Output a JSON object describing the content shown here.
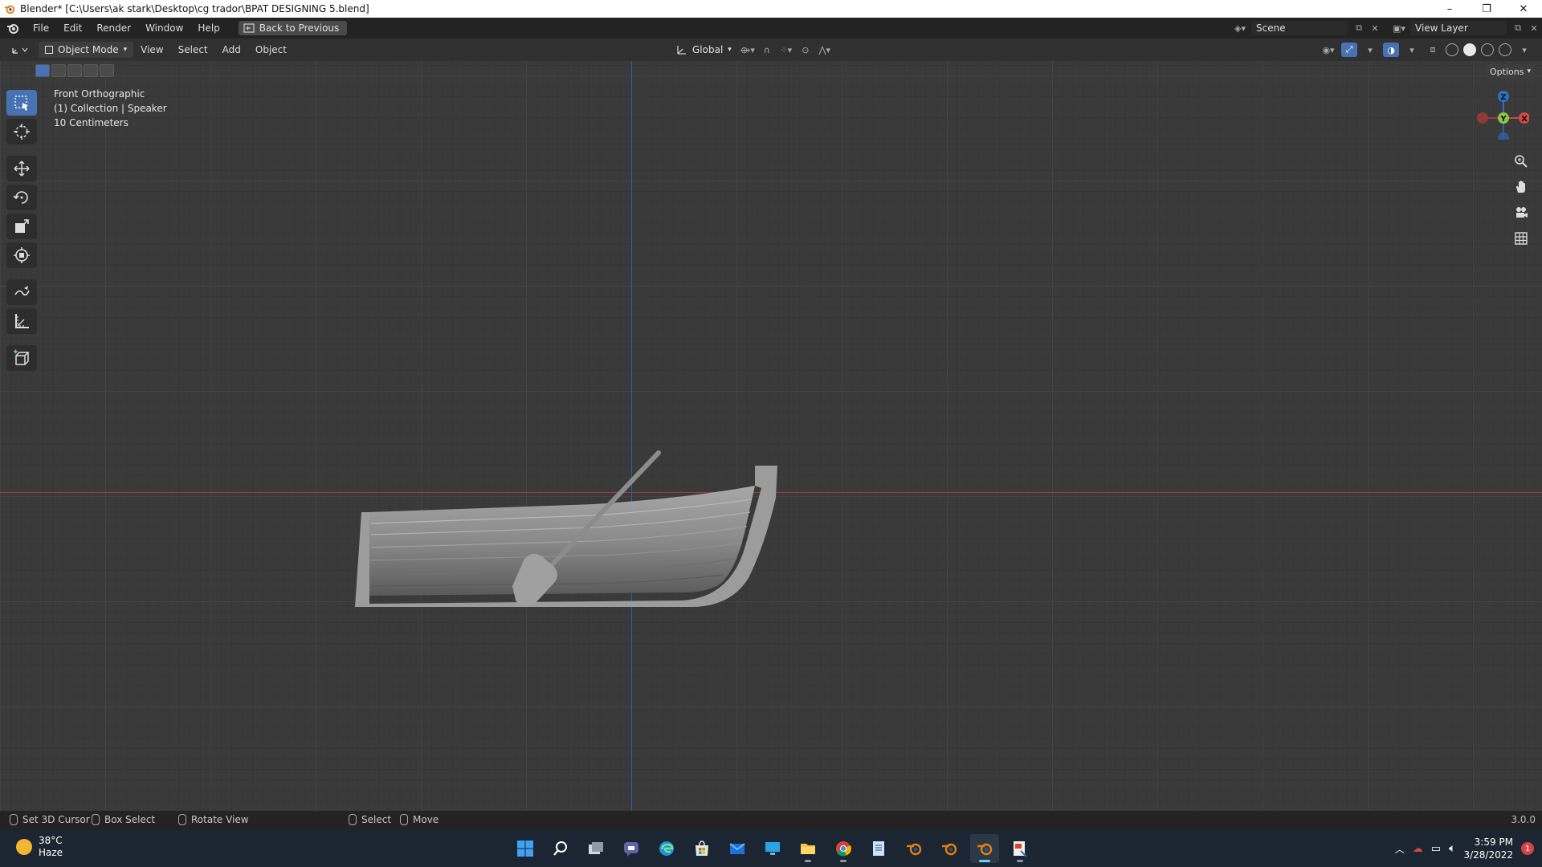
{
  "window": {
    "title": "Blender* [C:\\Users\\ak stark\\Desktop\\cg trador\\BPAT DESIGNING 5.blend]",
    "controls": [
      "–",
      "❐",
      "✕"
    ]
  },
  "topbar": {
    "menus": [
      "File",
      "Edit",
      "Render",
      "Window",
      "Help"
    ],
    "back_button": "Back to Previous",
    "scene": "Scene",
    "view_layer": "View Layer"
  },
  "viewport_header": {
    "mode": "Object Mode",
    "menus": [
      "View",
      "Select",
      "Add",
      "Object"
    ],
    "orientation": "Global",
    "options": "Options"
  },
  "viewport": {
    "view_name": "Front Orthographic",
    "collection": "(1) Collection | Speaker",
    "scale": "10 Centimeters",
    "gizmo_axes": {
      "z": "Z",
      "y": "Y",
      "x": "X"
    },
    "colors": {
      "x_axis": "#a23b3b",
      "z_axis": "#2f5fa5",
      "accent": "#4772b3"
    }
  },
  "toolbar": {
    "tools": [
      "select-box",
      "cursor",
      "move",
      "rotate",
      "scale",
      "transform",
      "annotate",
      "measure",
      "add-cube"
    ],
    "active": "select-box"
  },
  "statusbar": {
    "hints": [
      "Set 3D Cursor",
      "Box Select",
      "Rotate View",
      "Select",
      "Move"
    ],
    "version": "3.0.0"
  },
  "taskbar": {
    "weather_temp": "38°C",
    "weather_desc": "Haze",
    "time": "3:59 PM",
    "date": "3/28/2022",
    "notifications": "1",
    "apps": [
      "windows-start",
      "search",
      "task-view",
      "teams-chat",
      "edge",
      "store",
      "mail",
      "monitor",
      "file-explorer",
      "chrome",
      "blender",
      "blender",
      "blender",
      "app"
    ]
  }
}
